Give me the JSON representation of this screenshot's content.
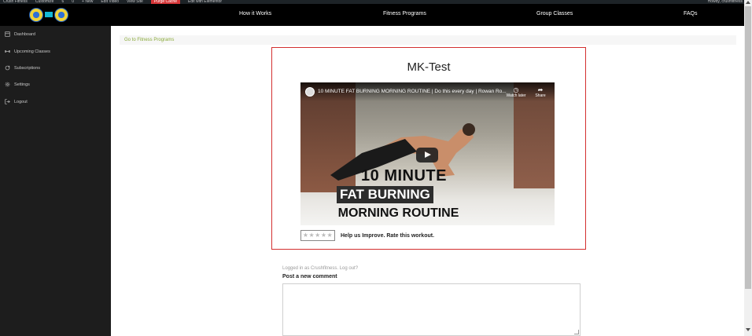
{
  "admin_bar": {
    "items": [
      "Crush Fitness",
      "Customize",
      "6",
      "0",
      "+ New",
      "Edit Video",
      "View Site",
      "Purge Cache",
      "Edit with Elementor"
    ],
    "right": "Howdy, crushfitness"
  },
  "header": {
    "nav": [
      "How it Works",
      "Fitness Programs",
      "Group Classes",
      "FAQs"
    ]
  },
  "sidebar": {
    "items": [
      {
        "label": "Dashboard",
        "icon": "dashboard-icon"
      },
      {
        "label": "Upcoming Classes",
        "icon": "dumbbell-icon"
      },
      {
        "label": "Subscriptions",
        "icon": "refresh-icon"
      },
      {
        "label": "Settings",
        "icon": "gear-icon"
      },
      {
        "label": "Logout",
        "icon": "logout-icon"
      }
    ]
  },
  "breadcrumb": "Go to Fitness Programs",
  "workout": {
    "title": "MK-Test",
    "video": {
      "title": "10 MINUTE FAT BURNING MORNING ROUTINE | Do this every day | Rowan Ro...",
      "watch_later": "Watch later",
      "share": "Share",
      "overlay_lines": [
        "10 MINUTE",
        "FAT BURNING",
        "MORNING ROUTINE"
      ]
    },
    "rating_stars": "★★★★★",
    "rating_value": 0,
    "rating_prompt": "Help us Improve. Rate this workout."
  },
  "comments": {
    "logged_in": "Logged in as Crushfitness. Log out?",
    "post_title": "Post a new comment"
  },
  "colors": {
    "highlight_border": "#d32f2f",
    "breadcrumb_link": "#8aaa3a",
    "header_bg": "#000000",
    "sidebar_bg": "#1d1d1d"
  }
}
